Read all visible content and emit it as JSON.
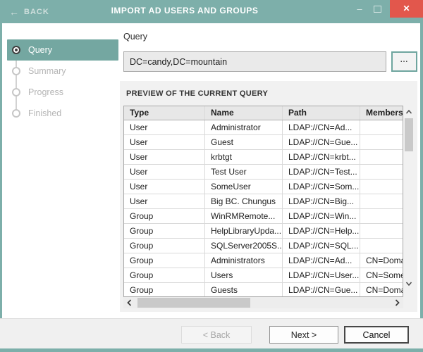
{
  "titlebar": {
    "back_label": "BACK",
    "title": "IMPORT AD USERS AND GROUPS",
    "icons": {
      "back": "←",
      "minimize": "–",
      "maximize": "□",
      "close": "✕"
    }
  },
  "colors": {
    "teal_header": "#7dafaa",
    "teal_accent": "#74a7a1",
    "close_red": "#e2574c",
    "panel_bg": "#f1f1f1",
    "footer_bg": "#f0f0f0"
  },
  "steps": {
    "items": [
      {
        "label": "Query",
        "active": true
      },
      {
        "label": "Summary",
        "active": false
      },
      {
        "label": "Progress",
        "active": false
      },
      {
        "label": "Finished",
        "active": false
      }
    ]
  },
  "query": {
    "label": "Query",
    "value": "DC=candy,DC=mountain",
    "browse_label": "..."
  },
  "preview": {
    "title": "PREVIEW OF THE CURRENT QUERY",
    "columns": [
      "Type",
      "Name",
      "Path",
      "Members"
    ],
    "rows": [
      [
        "User",
        "Administrator",
        "LDAP://CN=Ad...",
        ""
      ],
      [
        "User",
        "Guest",
        "LDAP://CN=Gue...",
        ""
      ],
      [
        "User",
        "krbtgt",
        "LDAP://CN=krbt...",
        ""
      ],
      [
        "User",
        "Test User",
        "LDAP://CN=Test...",
        ""
      ],
      [
        "User",
        "SomeUser",
        "LDAP://CN=Som...",
        ""
      ],
      [
        "User",
        "Big BC. Chungus",
        "LDAP://CN=Big...",
        ""
      ],
      [
        "Group",
        "WinRMRemote...",
        "LDAP://CN=Win...",
        ""
      ],
      [
        "Group",
        "HelpLibraryUpda...",
        "LDAP://CN=Help...",
        ""
      ],
      [
        "Group",
        "SQLServer2005S...",
        "LDAP://CN=SQL...",
        ""
      ],
      [
        "Group",
        "Administrators",
        "LDAP://CN=Ad...",
        "CN=Doma"
      ],
      [
        "Group",
        "Users",
        "LDAP://CN=User...",
        "CN=Somel"
      ],
      [
        "Group",
        "Guests",
        "LDAP://CN=Gue...",
        "CN=Doma"
      ]
    ]
  },
  "footer": {
    "back_label": "< Back",
    "next_label": "Next >",
    "cancel_label": "Cancel"
  }
}
